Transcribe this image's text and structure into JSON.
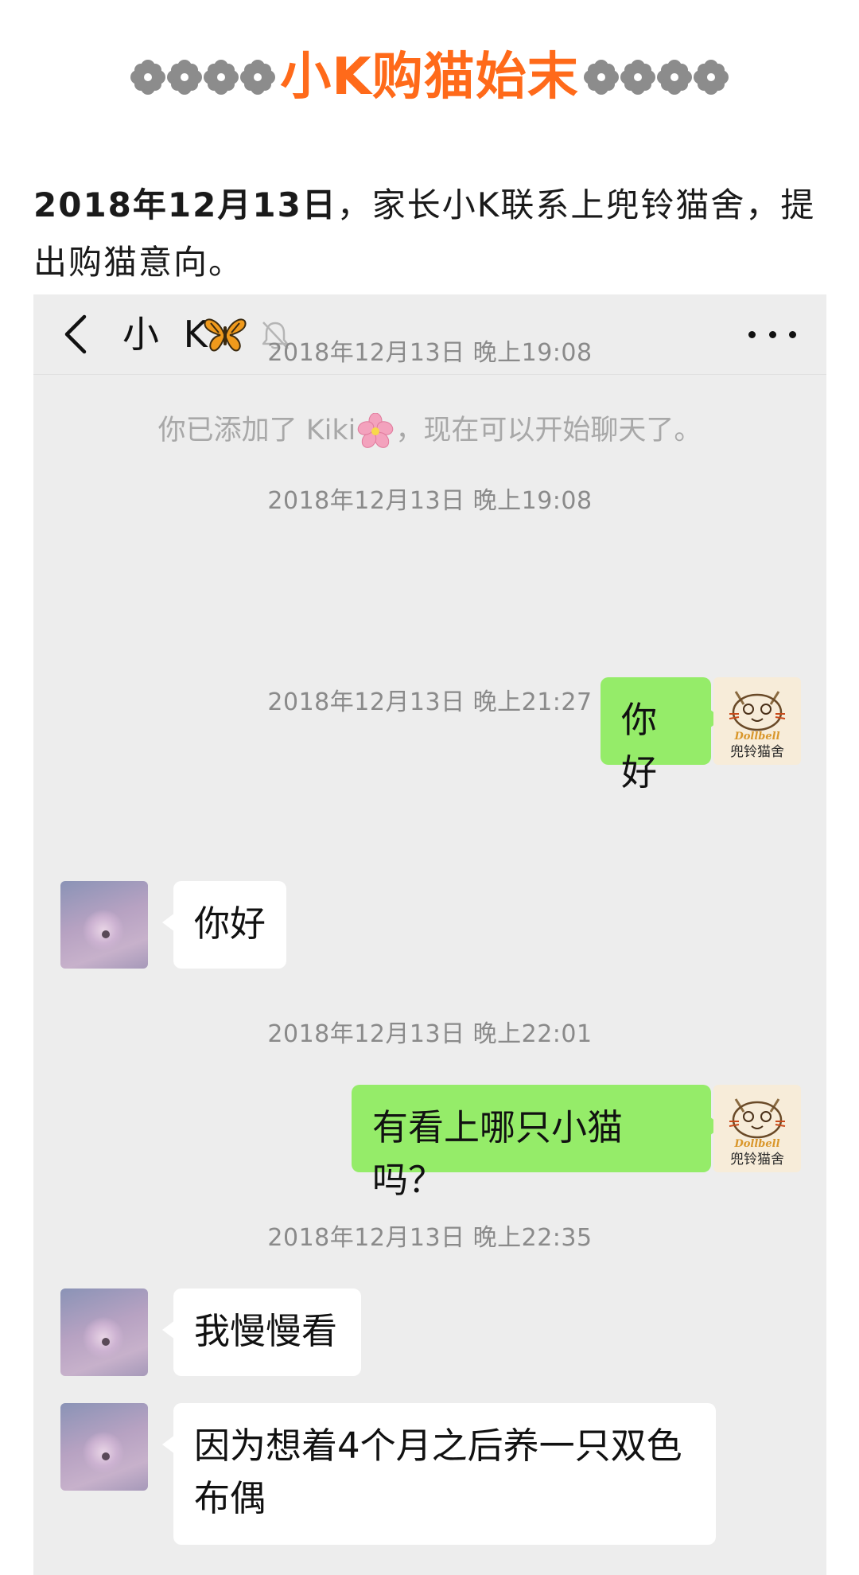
{
  "article": {
    "title": "小K购猫始末",
    "intro_bold": "2018年12月13日",
    "intro_rest": "，家长小K联系上兜铃猫舍，提出购猫意向。"
  },
  "chat": {
    "contact_name": "小 K",
    "header_icons": [
      "back-icon",
      "butterfly-icon",
      "mute-bell-icon",
      "more-icon"
    ],
    "shop_avatar_text": {
      "top": "Dollbell",
      "bottom": "兜铃猫舍"
    },
    "timestamps": [
      "2018年12月13日 晚上19:08",
      "2018年12月13日 晚上19:08",
      "2018年12月13日 晚上21:27",
      "2018年12月13日 晚上22:01",
      "2018年12月13日 晚上22:35"
    ],
    "system_message": {
      "before": "你已添加了 Kiki",
      "after": "，现在可以开始聊天了。"
    },
    "messages": [
      {
        "side": "right",
        "text": "你好"
      },
      {
        "side": "left",
        "text": "你好"
      },
      {
        "side": "right",
        "text": "有看上哪只小猫吗？"
      },
      {
        "side": "left",
        "text": "我慢慢看"
      },
      {
        "side": "left",
        "text": "因为想着4个月之后养一只双色布偶"
      }
    ]
  },
  "colors": {
    "title_orange": "#ff6a1a",
    "chat_background": "#ededed",
    "sent_bubble": "#95ec69",
    "received_bubble": "#ffffff",
    "timestamp_gray": "#8a8a8a"
  }
}
